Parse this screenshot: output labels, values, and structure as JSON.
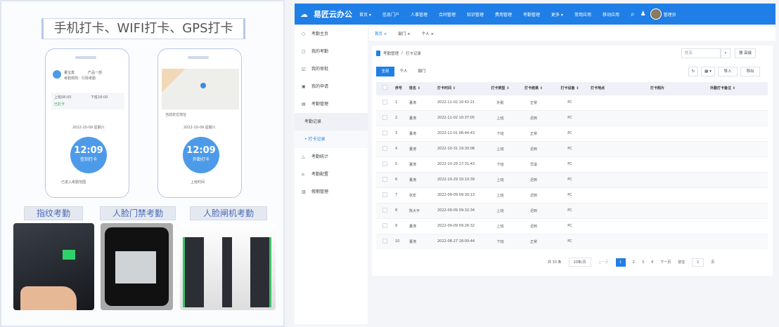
{
  "left": {
    "title": "手机打卡、WIFI打卡、GPS打卡",
    "phone1": {
      "user": "董宝勇",
      "dept": "产品一部",
      "rule": "考勤规则：行政考勤",
      "on_label": "上班08:00",
      "off_label": "下班18:00",
      "on_status": "已打卡",
      "date": "2022-10-09 星期六",
      "time": "12:09",
      "action": "签到打卡",
      "footer": "已进入考勤范围"
    },
    "phone2": {
      "date": "2022-10-09 星期六",
      "time": "12:09",
      "action": "外勤打卡",
      "footer": "上班时间",
      "address": "当前定位地址"
    },
    "methods": [
      "指纹考勤",
      "人脸门禁考勤",
      "人脸闸机考勤"
    ]
  },
  "app": {
    "logo": "易匠云办公",
    "nav": [
      "首页 ▾",
      "信息门户",
      "人事管理",
      "合同管理",
      "知识管理",
      "费用管理",
      "考勤管理",
      "更多 ▾",
      "常用应用",
      "移动应用"
    ],
    "user": "管理员",
    "sidebar": [
      {
        "icon": "○",
        "label": "考勤主页"
      },
      {
        "icon": "▢",
        "label": "我的考勤"
      },
      {
        "icon": "◱",
        "label": "我的审批"
      },
      {
        "icon": "▣",
        "label": "我的申请"
      },
      {
        "icon": "▤",
        "label": "考勤管理"
      },
      {
        "label": "考勤记录",
        "sub": true
      },
      {
        "label": "• 打卡记录",
        "sub": true,
        "active": true
      },
      {
        "icon": "△",
        "label": "考勤统计"
      },
      {
        "icon": "⌂",
        "label": "考勤配置"
      },
      {
        "icon": "▥",
        "label": "假期管理"
      }
    ],
    "tabs": [
      "首页 ×",
      "部门 ×",
      "个人 ×"
    ],
    "breadcrumb": [
      "考勤管理",
      "打卡记录"
    ],
    "search_placeholder": "姓名",
    "search_btn": "⌕",
    "query_btn": "搜 高级",
    "segments": [
      "全部",
      "个人",
      "部门"
    ],
    "tools": {
      "refresh": "↻",
      "columns": "▦ ▾",
      "import": "导入",
      "export": "导出"
    },
    "columns": [
      "序号",
      "姓名 ↕",
      "打卡时间 ↕",
      "打卡类型 ↕",
      "打卡结果 ↕",
      "打卡设备 ↕",
      "打卡地点",
      "打卡照片",
      "外勤打卡备注 ↕"
    ],
    "rows": [
      [
        "1",
        "董涛",
        "2022-11-02 10:42:21",
        "外勤",
        "正常",
        "PC"
      ],
      [
        "2",
        "董涛",
        "2022-11-02 10:37:05",
        "上班",
        "迟到",
        "PC"
      ],
      [
        "3",
        "董涛",
        "2022-11-01 08:44:43",
        "下班",
        "正常",
        "PC"
      ],
      [
        "4",
        "董涛",
        "2022-10-31 19:30:08",
        "上班",
        "迟到",
        "PC"
      ],
      [
        "5",
        "董涛",
        "2022-10-29 17:31:43",
        "下班",
        "早退",
        "PC"
      ],
      [
        "6",
        "董涛",
        "2022-10-29 10:10:39",
        "上班",
        "迟到",
        "PC"
      ],
      [
        "7",
        "张宏",
        "2022-09-09 09:30:13",
        "上班",
        "迟到",
        "PC"
      ],
      [
        "8",
        "陈大平",
        "2022-09-09 09:32:34",
        "上班",
        "迟到",
        "PC"
      ],
      [
        "9",
        "董涛",
        "2022-09-09 09:26:32",
        "上班",
        "迟到",
        "PC"
      ],
      [
        "10",
        "董涛",
        "2022-08-27 18:00:44",
        "下班",
        "正常",
        "PC"
      ]
    ],
    "pagination": {
      "total": "共 33 条",
      "size": "10条/页",
      "prev": "上一页",
      "pages": [
        "1",
        "2",
        "3",
        "4"
      ],
      "next": "下一页",
      "goto": "前往",
      "goto_page": "1",
      "unit": "页"
    }
  }
}
